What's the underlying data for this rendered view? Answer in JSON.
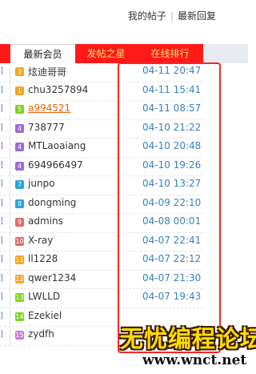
{
  "top_links": {
    "my_posts": "我的帖子",
    "separator": "|",
    "latest_replies": "最新回复"
  },
  "tabs": [
    {
      "label": "最新会员",
      "active": true
    },
    {
      "label": "发帖之星",
      "active": false
    },
    {
      "label": "在线排行",
      "active": false
    }
  ],
  "members": [
    {
      "stub": "]",
      "rank": "3",
      "rank_color": "#f5a623",
      "name": "炫迪哥哥",
      "time": "04-11 20:47"
    },
    {
      "stub": "]",
      "rank": "1",
      "rank_color": "#f5a623",
      "name": "chu3257894",
      "time": "04-11 15:41"
    },
    {
      "stub": "]",
      "rank": "5",
      "rank_color": "#7ed321",
      "name": "a994521",
      "time": "04-11 08:57",
      "highlight": true
    },
    {
      "stub": "]",
      "rank": "4",
      "rank_color": "#9b6dd6",
      "name": "738777",
      "time": "04-10 21:22"
    },
    {
      "stub": "]",
      "rank": "4",
      "rank_color": "#9b6dd6",
      "name": "MTLaoaiang",
      "time": "04-10 20:48"
    },
    {
      "stub": "]",
      "rank": "4",
      "rank_color": "#9b6dd6",
      "name": "694966497",
      "time": "04-10 19:26"
    },
    {
      "stub": "]",
      "rank": "7",
      "rank_color": "#29a6e0",
      "name": "junpo",
      "time": "04-10 13:27"
    },
    {
      "stub": "]",
      "rank": "8",
      "rank_color": "#29a6e0",
      "name": "dongming",
      "time": "04-09 22:10"
    },
    {
      "stub": "]",
      "rank": "9",
      "rank_color": "#e06c6c",
      "name": "admins",
      "time": "04-08 00:01"
    },
    {
      "stub": "]",
      "rank": "10",
      "rank_color": "#e06c6c",
      "name": "X-ray",
      "time": "04-07 22:41"
    },
    {
      "stub": "]",
      "rank": "11",
      "rank_color": "#f5a623",
      "name": "ll1228",
      "time": "04-07 22:12"
    },
    {
      "stub": "]",
      "rank": "12",
      "rank_color": "#f5a623",
      "name": "qwer1234",
      "time": "04-07 21:30"
    },
    {
      "stub": "]",
      "rank": "13",
      "rank_color": "#7ed321",
      "name": "LWLLD",
      "time": "04-07 19:43"
    },
    {
      "stub": "]",
      "rank": "14",
      "rank_color": "#7ed321",
      "name": "Ezekiel",
      "time": ""
    },
    {
      "stub": "]",
      "rank": "15",
      "rank_color": "#c77dd6",
      "name": "zydfh",
      "time": ""
    }
  ],
  "watermark": {
    "title": "无忧编程论坛",
    "url": "www.wnct.net"
  },
  "colors": {
    "tab_red": "#ff1a1a",
    "tab_text": "#ffe066",
    "time_blue": "#3a80c2",
    "outline_red": "#ff2222",
    "link_orange": "#e8620c"
  }
}
